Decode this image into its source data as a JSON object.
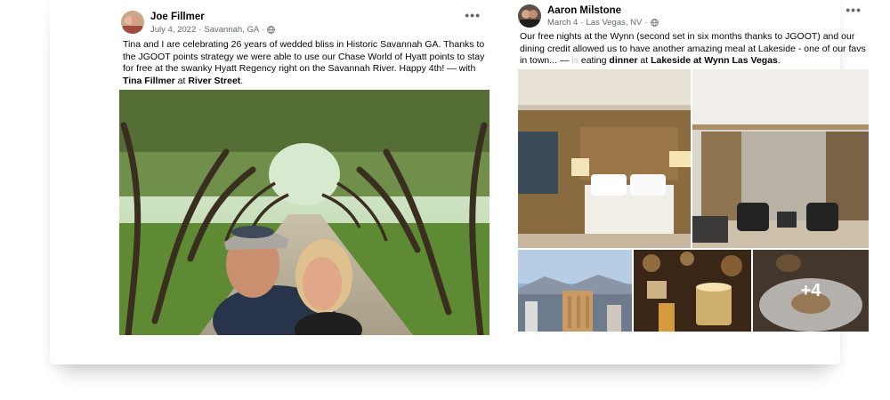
{
  "left_post": {
    "author": "Joe Fillmer",
    "date": "July 4, 2022",
    "location": "Savannah, GA",
    "body": "Tina and I are celebrating 26 years of wedded bliss in Historic Savannah GA.  Thanks to the JGOOT points strategy we were able to use our Chase World of Hyatt points to stay for free at the swanky Hyatt Regency right on the Savannah River. Happy 4th! — with ",
    "tag_person": "Tina Fillmer",
    "tag_sep": " at ",
    "tag_place": "River Street",
    "tag_end": "."
  },
  "right_post": {
    "author": "Aaron Milstone",
    "date": "March 4",
    "location": "Las Vegas, NV",
    "body": "Our free nights at the Wynn (second set in six months thanks to JGOOT) and our dining credit allowed us to have another amazing meal at Lakeside - one of our favs in town... — ",
    "faded_word": "is",
    "activity": " eating ",
    "activity_bold": "dinner",
    "tag_sep": " at ",
    "tag_place": "Lakeside at Wynn Las Vegas",
    "tag_end": ".",
    "more_photos": "+4"
  },
  "ui": {
    "meta_sep": "·",
    "more_dots": "•••"
  },
  "icons": {
    "options": "more-options-icon",
    "audience": "globe-icon"
  }
}
